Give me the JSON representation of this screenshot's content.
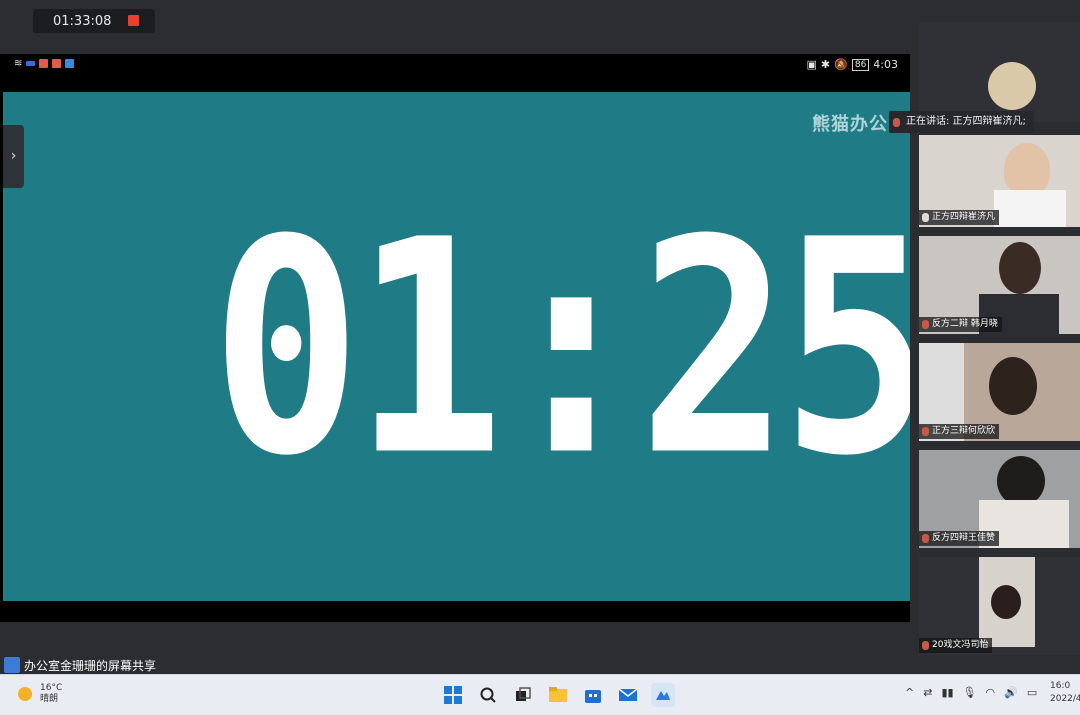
{
  "recording": {
    "elapsed": "01:33:08"
  },
  "phone_status": {
    "battery": "86",
    "time": "4:03"
  },
  "shared_screen": {
    "brand": "熊猫办公",
    "timer": "01:25"
  },
  "share_label": "办公室金珊珊的屏幕共享",
  "speaking_now": "正在讲话: 正方四辩崔济凡;",
  "participants": [
    {
      "name": "",
      "muted": false
    },
    {
      "name": "正方四辩崔济凡",
      "muted": false
    },
    {
      "name": "反方二辩 韩月晓",
      "muted": true
    },
    {
      "name": "正方三辩何欣欣",
      "muted": true
    },
    {
      "name": "反方四辩王佳赞",
      "muted": true
    },
    {
      "name": "20戏文冯司怡",
      "muted": true
    }
  ],
  "taskbar": {
    "temperature": "16°C",
    "weather": "晴朗",
    "time": "16:0",
    "date": "2022/4"
  },
  "colors": {
    "teal": "#1f7b85",
    "record": "#e8412f",
    "accent": "#3d7bd9"
  }
}
